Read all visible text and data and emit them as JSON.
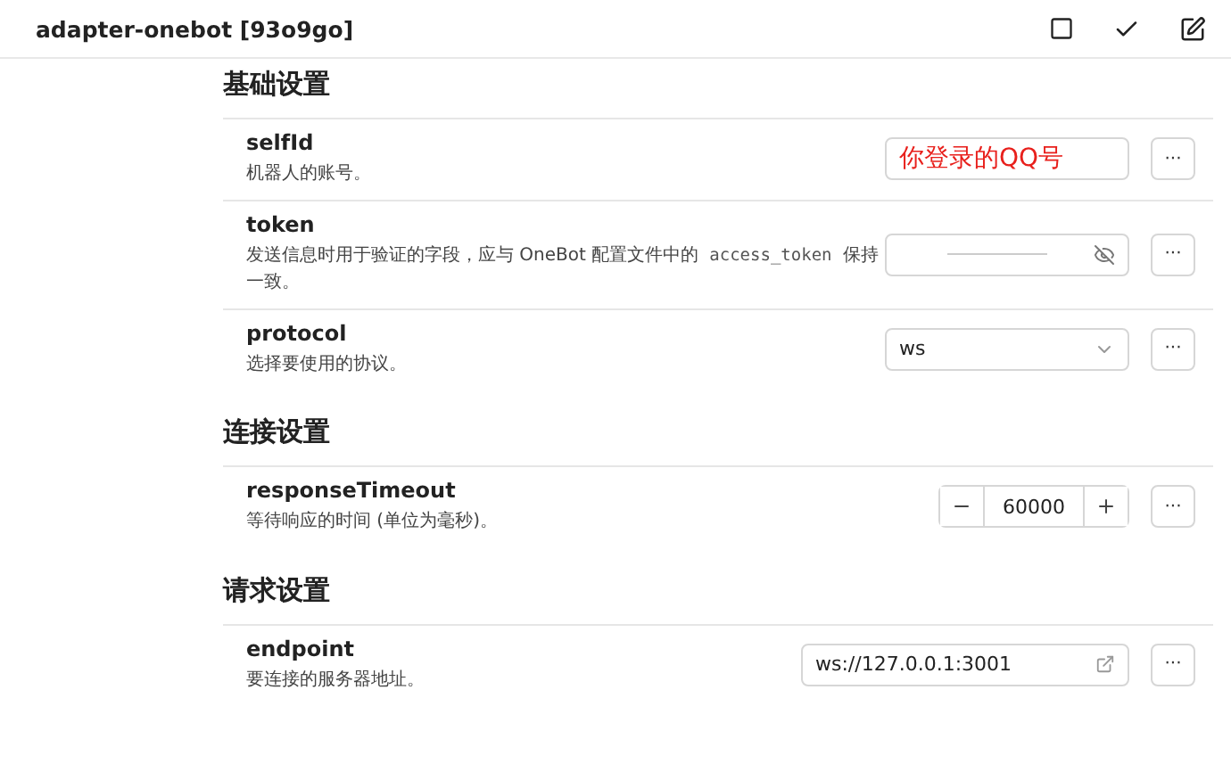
{
  "header": {
    "title": "adapter-onebot [93o9go]"
  },
  "sections": [
    {
      "title": "基础设置",
      "items": [
        {
          "name": "selfId",
          "description": [
            {
              "kind": "text",
              "text": "机器人的账号。"
            }
          ],
          "control": {
            "kind": "annotation",
            "value": "你登录的QQ号"
          },
          "more": "···"
        },
        {
          "name": "token",
          "description": [
            {
              "kind": "text",
              "text": "发送信息时用于验证的字段，应与 OneBot 配置文件中的"
            },
            {
              "kind": "code",
              "text": "access_token"
            },
            {
              "kind": "text",
              "text": "保持一致。"
            }
          ],
          "control": {
            "kind": "password"
          },
          "more": "···"
        },
        {
          "name": "protocol",
          "description": [
            {
              "kind": "text",
              "text": "选择要使用的协议。"
            }
          ],
          "control": {
            "kind": "select",
            "value": "ws"
          },
          "more": "···"
        }
      ]
    },
    {
      "title": "连接设置",
      "items": [
        {
          "name": "responseTimeout",
          "description": [
            {
              "kind": "text",
              "text": "等待响应的时间 (单位为毫秒)。"
            }
          ],
          "control": {
            "kind": "number",
            "value": "60000"
          },
          "more": "···"
        }
      ]
    },
    {
      "title": "请求设置",
      "items": [
        {
          "name": "endpoint",
          "description": [
            {
              "kind": "text",
              "text": "要连接的服务器地址。"
            }
          ],
          "control": {
            "kind": "url",
            "value": "ws://127.0.0.1:3001"
          },
          "more": "···"
        }
      ]
    }
  ]
}
